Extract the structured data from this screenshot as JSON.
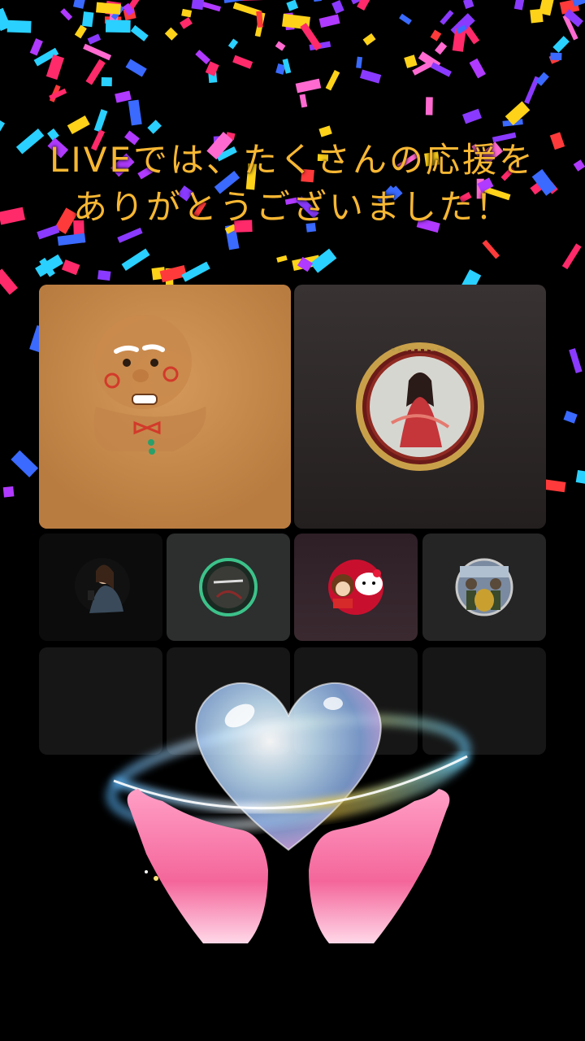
{
  "live": {
    "message": "LIVEでは、たくさんの応援をありがとうございました！"
  },
  "participants": [
    {
      "avatar": "gingerbread-man-avatar"
    },
    {
      "avatar": "princess-medallion-avatar"
    },
    {
      "avatar": "woman-with-phone-avatar"
    },
    {
      "avatar": "green-ring-avatar"
    },
    {
      "avatar": "kitty-and-doll-avatar"
    },
    {
      "avatar": "group-photo-avatar"
    }
  ],
  "effects": {
    "gift": "heart-planet-hands-icon",
    "confetti": "confetti-shower"
  },
  "colors": {
    "background": "#000000",
    "title": "#f7b733",
    "tile_orange": "#c68a4c",
    "tile_dark": "#2a2525"
  }
}
